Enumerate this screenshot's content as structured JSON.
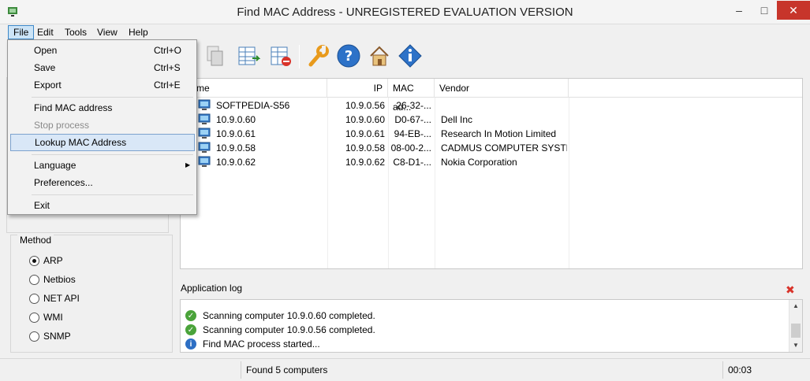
{
  "window": {
    "title": "Find MAC Address - UNREGISTERED EVALUATION VERSION",
    "minimize": "–",
    "maximize": "□",
    "close": "✕"
  },
  "menubar": {
    "items": [
      "File",
      "Edit",
      "Tools",
      "View",
      "Help"
    ]
  },
  "file_menu": {
    "items": [
      {
        "label": "Open",
        "shortcut": "Ctrl+O"
      },
      {
        "label": "Save",
        "shortcut": "Ctrl+S"
      },
      {
        "label": "Export",
        "shortcut": "Ctrl+E"
      },
      {
        "label": "Find MAC address",
        "shortcut": ""
      },
      {
        "label": "Stop process",
        "shortcut": "",
        "disabled": true
      },
      {
        "label": "Lookup MAC Address",
        "shortcut": "",
        "highlighted": true
      },
      {
        "label": "Language",
        "shortcut": "",
        "submenu": true
      },
      {
        "label": "Preferences...",
        "shortcut": ""
      },
      {
        "label": "Exit",
        "shortcut": ""
      }
    ],
    "submenu_arrow": "▶"
  },
  "toolbar": {
    "icons": [
      "copy-icon",
      "paste-icon",
      "table-export-icon",
      "table-remove-icon",
      "tools-wrench-icon",
      "help-icon",
      "home-icon",
      "info-icon"
    ]
  },
  "method": {
    "title": "Method",
    "options": [
      "ARP",
      "Netbios",
      "NET API",
      "WMI",
      "SNMP"
    ],
    "selected": "ARP"
  },
  "results": {
    "columns": [
      "me",
      "IP",
      "MAC ad...",
      "Vendor"
    ],
    "rows": [
      {
        "name": "SOFTPEDIA-S56",
        "ip": "10.9.0.56",
        "mac": "26-32-...",
        "vendor": ""
      },
      {
        "name": "10.9.0.60",
        "ip": "10.9.0.60",
        "mac": "D0-67-...",
        "vendor": "Dell Inc"
      },
      {
        "name": "10.9.0.61",
        "ip": "10.9.0.61",
        "mac": "94-EB-...",
        "vendor": "Research In Motion Limited"
      },
      {
        "name": "10.9.0.58",
        "ip": "10.9.0.58",
        "mac": "08-00-2...",
        "vendor": "CADMUS COMPUTER SYSTE..."
      },
      {
        "name": "10.9.0.62",
        "ip": "10.9.0.62",
        "mac": "C8-D1-...",
        "vendor": "Nokia Corporation"
      }
    ]
  },
  "log": {
    "title": "Application log",
    "close": "✖",
    "entries": [
      {
        "type": "ok",
        "text": "Scanning computer 10.9.0.60 completed."
      },
      {
        "type": "ok",
        "text": "Scanning computer 10.9.0.56 completed."
      },
      {
        "type": "info",
        "text": "Find MAC process started..."
      }
    ],
    "scroll_up": "▲",
    "scroll_down": "▼"
  },
  "status": {
    "message": "Found 5 computers",
    "time": "00:03"
  },
  "colors": {
    "close_button": "#c7352b",
    "menu_highlight": "#d9e7f7",
    "log_ok": "#4aa33a",
    "log_info": "#2d6fc4"
  }
}
